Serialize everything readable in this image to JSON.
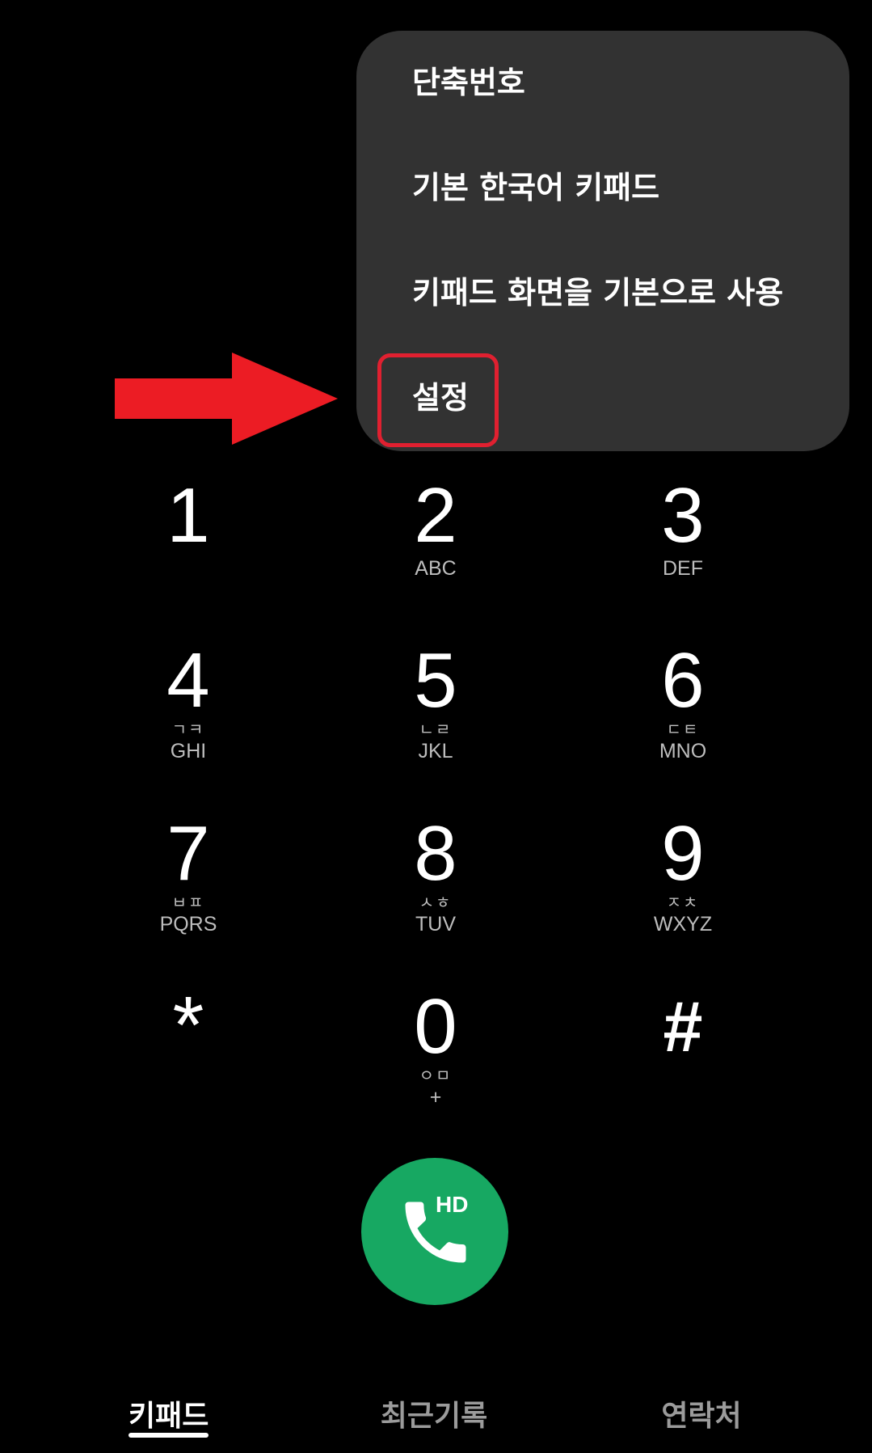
{
  "menu": {
    "items": [
      {
        "label": "단축번호"
      },
      {
        "label": "기본 한국어 키패드"
      },
      {
        "label": "키패드 화면을 기본으로 사용"
      },
      {
        "label": "설정"
      }
    ],
    "highlighted_index": 3
  },
  "annotation": {
    "arrow_color": "#ec1c24",
    "box_color": "#e02030"
  },
  "dialpad": {
    "keys": [
      {
        "digit": "1",
        "korean": "",
        "letters": ""
      },
      {
        "digit": "2",
        "korean": "",
        "letters": "ABC"
      },
      {
        "digit": "3",
        "korean": "",
        "letters": "DEF"
      },
      {
        "digit": "4",
        "korean": "ㄱㅋ",
        "letters": "GHI"
      },
      {
        "digit": "5",
        "korean": "ㄴㄹ",
        "letters": "JKL"
      },
      {
        "digit": "6",
        "korean": "ㄷㅌ",
        "letters": "MNO"
      },
      {
        "digit": "7",
        "korean": "ㅂㅍ",
        "letters": "PQRS"
      },
      {
        "digit": "8",
        "korean": "ㅅㅎ",
        "letters": "TUV"
      },
      {
        "digit": "9",
        "korean": "ㅈㅊ",
        "letters": "WXYZ"
      },
      {
        "digit": "*",
        "korean": "",
        "letters": ""
      },
      {
        "digit": "0",
        "korean": "ㅇㅁ",
        "letters": "+"
      },
      {
        "digit": "#",
        "korean": "",
        "letters": ""
      }
    ]
  },
  "call_button": {
    "icon": "phone-icon",
    "badge": "HD",
    "color": "#17a862"
  },
  "tabs": [
    {
      "label": "키패드",
      "active": true
    },
    {
      "label": "최근기록",
      "active": false
    },
    {
      "label": "연락처",
      "active": false
    }
  ]
}
